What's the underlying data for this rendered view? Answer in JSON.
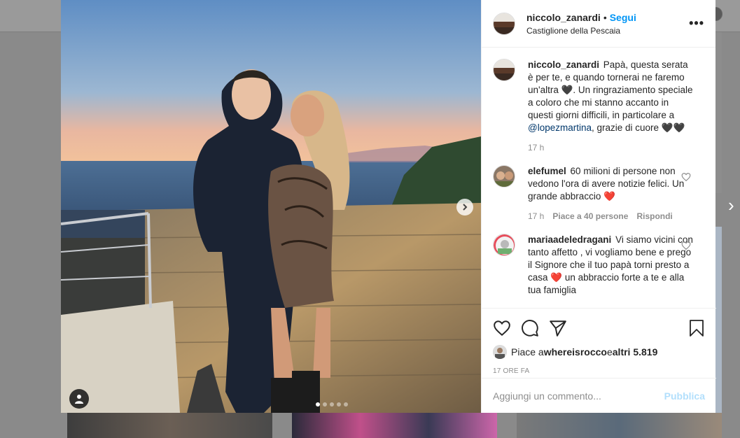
{
  "post": {
    "username": "niccolo_zanardi",
    "separator": "•",
    "follow_label": "Segui",
    "location": "Castiglione della Pescaia",
    "more_icon": "more-icon",
    "more_text": "•••"
  },
  "caption": {
    "username": "niccolo_zanardi",
    "text_part1": "Papà, questa serata è per te, e quando tornerai ne faremo un'altra 🖤. Un ringraziamento speciale a coloro che mi stanno accanto in questi giorni difficili, in particolare a ",
    "mention": "@lopezmartina",
    "text_part2": ", grazie di cuore 🖤🖤",
    "time": "17 h"
  },
  "comments": [
    {
      "username": "elefumel",
      "text": "60 milioni di persone non vedono l'ora di avere notizie felici. Un grande abbraccio ",
      "emoji": "❤️",
      "time": "17 h",
      "likes": "Piace a 40 persone",
      "reply": "Rispondi"
    },
    {
      "username": "mariaadeledragani",
      "text": "Vi siamo vicini con tanto affetto , vi vogliamo bene e prego il Signore che il tuo papà torni presto a casa ",
      "emoji": "❤️",
      "text_after": " un abbraccio forte a te e alla tua famiglia"
    }
  ],
  "likes": {
    "prefix": "Piace a ",
    "user": "whereisrocco",
    "middle": " e ",
    "others": "altri 5.819"
  },
  "timestamp": "17 ORE FA",
  "comment_input": {
    "placeholder": "Aggiungi un commento...",
    "publish_label": "Pubblica"
  },
  "colors": {
    "accent": "#0095f6",
    "publish_disabled": "#b2dffc",
    "heart": "#ed4956"
  }
}
